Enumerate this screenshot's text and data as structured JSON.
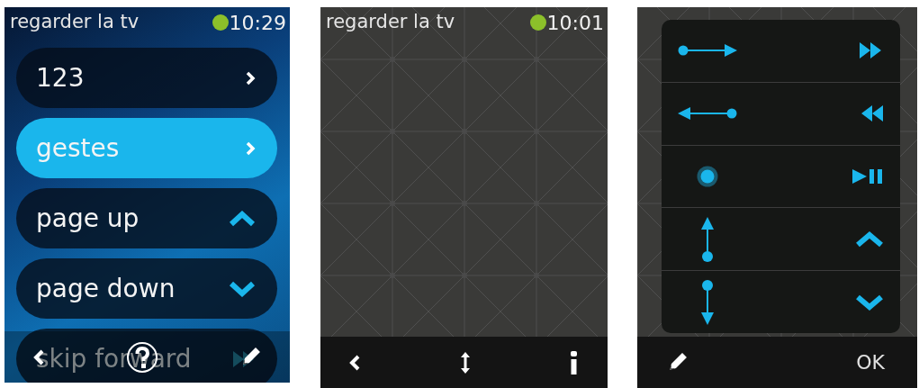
{
  "screens": [
    {
      "kind": "menu",
      "status_bar": {
        "title": "regarder la tv",
        "connected": true,
        "time": "10:29"
      },
      "items": [
        {
          "label": "123",
          "kind": "submenu",
          "selected": false
        },
        {
          "label": "gestes",
          "kind": "submenu",
          "selected": true
        },
        {
          "label": "page up",
          "kind": "up",
          "selected": false
        },
        {
          "label": "page down",
          "kind": "down",
          "selected": false
        },
        {
          "label": "skip forward",
          "kind": "forward",
          "selected": false
        }
      ],
      "bottom_bar": [
        {
          "kind": "back"
        },
        {
          "kind": "help"
        },
        {
          "kind": "edit"
        }
      ]
    },
    {
      "kind": "gesture-pad",
      "status_bar": {
        "title": "regarder la tv",
        "connected": true,
        "time": "10:01"
      },
      "bottom_bar": [
        {
          "kind": "back"
        },
        {
          "kind": "updown"
        },
        {
          "kind": "info"
        }
      ]
    },
    {
      "kind": "gesture-list",
      "gestures": [
        {
          "kind": "swipe-right"
        },
        {
          "kind": "swipe-left"
        },
        {
          "kind": "tap"
        },
        {
          "kind": "swipe-up"
        },
        {
          "kind": "swipe-down"
        }
      ],
      "bottom_bar": [
        {
          "kind": "edit"
        },
        {
          "kind": "ok",
          "label": "OK"
        }
      ]
    }
  ]
}
